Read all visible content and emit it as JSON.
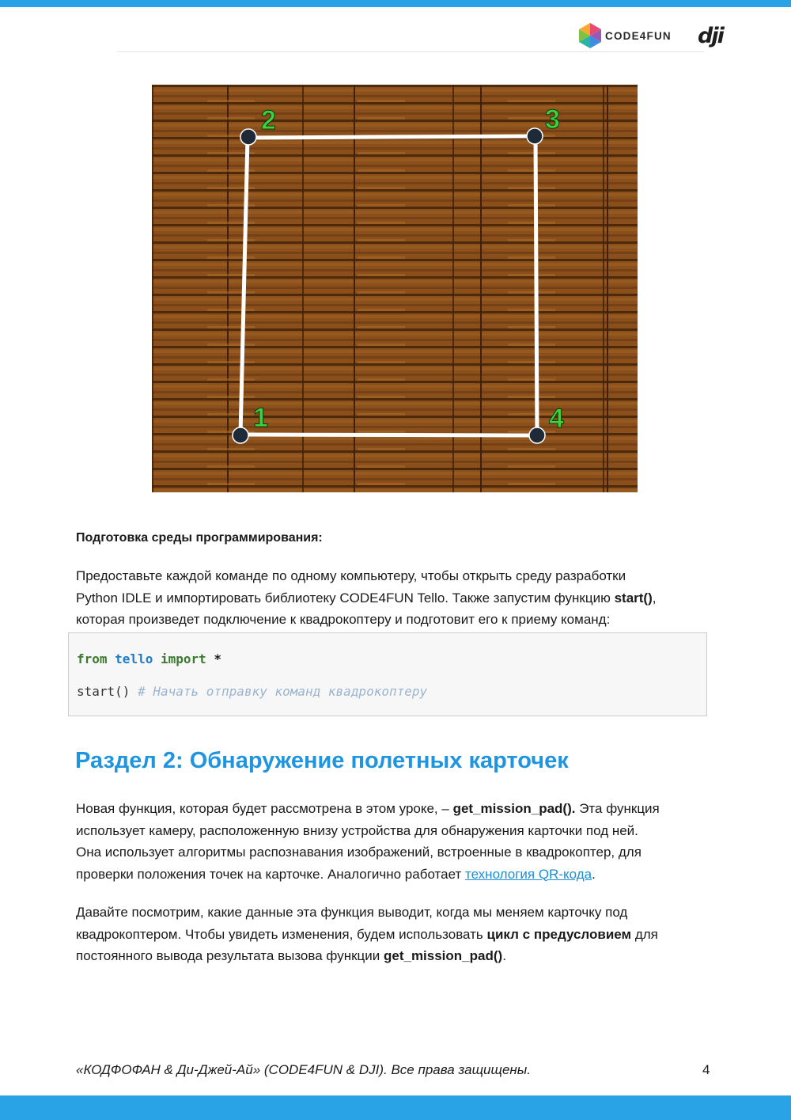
{
  "header": {
    "logo_text": "CODE4FUN",
    "partner_logo": "dji",
    "brand_color": "#29a3e6"
  },
  "figure": {
    "markers": [
      "1",
      "2",
      "3",
      "4"
    ],
    "marker_color": "#3fd13f"
  },
  "prep": {
    "heading": "Подготовка среды программирования:",
    "line1": "Предоставьте каждой команде по одному компьютеру, чтобы открыть среду разработки",
    "line2_a": "Python IDLE и импортировать библиотеку CODE4FUN Tello. Также запустим функцию ",
    "line2_b": "start()",
    "line2_c": ",",
    "line3": "которая произведет подключение к квадрокоптеру и подготовит его к приему команд:"
  },
  "code": {
    "kw_from": "from",
    "module": "tello",
    "kw_import": "import",
    "star": "*",
    "call": "start()",
    "comment": "# Начать отправку команд квадрокоптеру"
  },
  "section": {
    "title": "Раздел 2: Обнаружение полетных карточек",
    "p1_l1_a": "Новая функция, которая будет рассмотрена в этом уроке, – ",
    "p1_l1_b": "get_mission_pad().",
    "p1_l1_c": " Эта функция",
    "p1_l2": "использует камеру, расположенную внизу устройства для обнаружения карточки под ней.",
    "p1_l3": "Она использует алгоритмы распознавания изображений, встроенные в квадрокоптер, для",
    "p1_l4_a": "проверки положения точек на карточке. Аналогично  работает ",
    "p1_l4_link": "технология QR-кода",
    "p1_l4_c": ".",
    "p2_l1": "Давайте посмотрим, какие данные эта функция выводит, когда мы меняем карточку под",
    "p2_l2_a": "квадрокоптером. Чтобы увидеть изменения, будем использовать ",
    "p2_l2_b": "цикл с предусловием",
    "p2_l2_c": " для",
    "p2_l3_a": "постоянного вывода результата вызова функции ",
    "p2_l3_b": "get_mission_pad()",
    "p2_l3_c": "."
  },
  "footer": {
    "text": "«КОДФОФАН & Ди-Джей-Ай» (CODE4FUN & DJI). Все права защищены.",
    "page": "4"
  }
}
